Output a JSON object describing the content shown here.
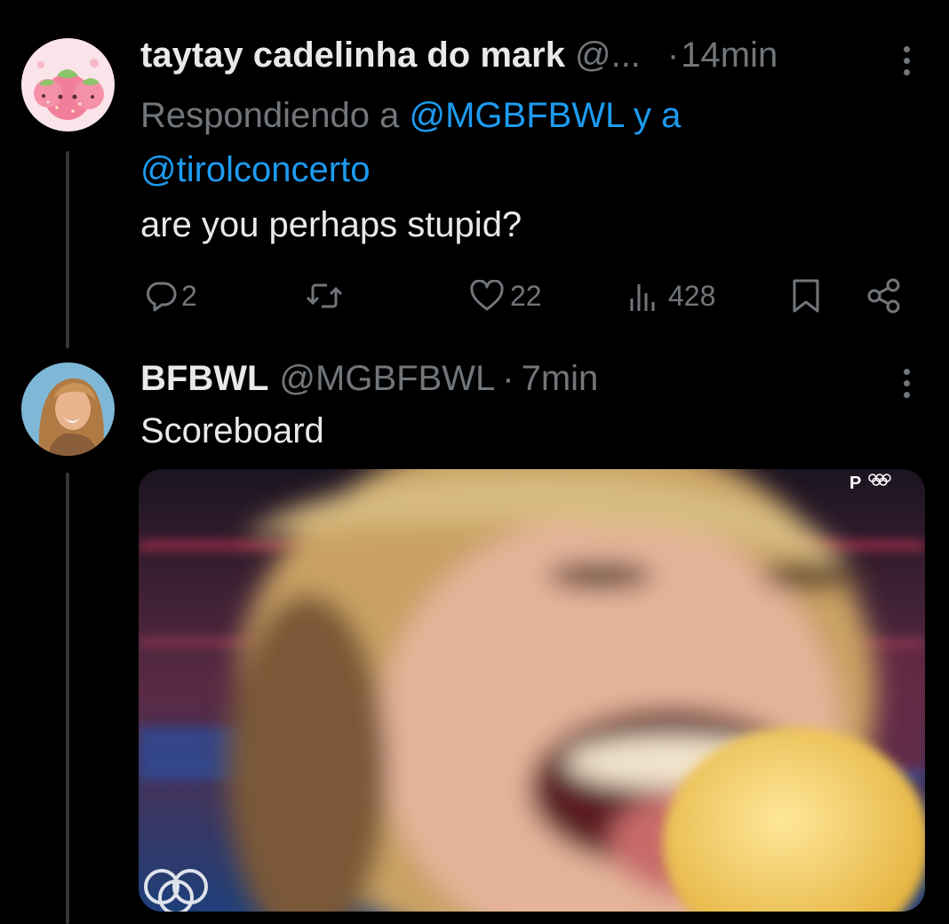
{
  "tweets": [
    {
      "display_name": "taytay cadelinha do mark",
      "handle": "@...",
      "separator": "·",
      "time": "14min",
      "reply_prefix": "Respondiendo a",
      "reply_user_1": "@MGBFBWL",
      "reply_conjunction": "y a",
      "reply_user_2": "@tirolconcerto",
      "text": "are you perhaps stupid?",
      "stats": {
        "replies": "2",
        "likes": "22",
        "views": "428"
      }
    },
    {
      "display_name": "BFBWL",
      "handle": "@MGBFBWL",
      "separator": "·",
      "time": "7min",
      "text": "Scoreboard",
      "media_watermark": "P"
    }
  ],
  "icons": {
    "reply": "reply-icon",
    "retweet": "retweet-icon",
    "like": "heart-icon",
    "views": "views-icon",
    "bookmark": "bookmark-icon",
    "share": "share-icon",
    "more": "more-options-icon"
  },
  "colors": {
    "background": "#000000",
    "primary_text": "#e7e9ea",
    "secondary_text": "#71767b",
    "link": "#1d9bf0",
    "thread_line": "#333639"
  }
}
